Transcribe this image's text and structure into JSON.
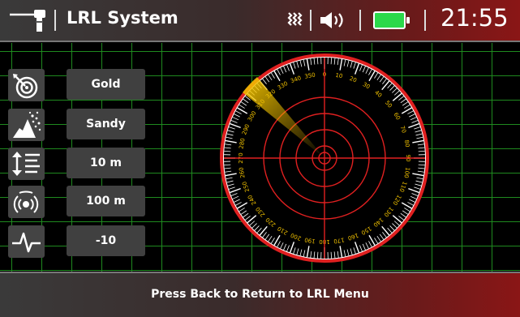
{
  "header": {
    "title": "LRL System",
    "time": "21:55",
    "icons": [
      "lrl-device-icon",
      "signal-icon",
      "volume-icon",
      "battery-icon"
    ],
    "battery_color": "#2bd94a"
  },
  "settings": [
    {
      "icon": "target-icon",
      "value": "Gold"
    },
    {
      "icon": "soil-icon",
      "value": "Sandy"
    },
    {
      "icon": "depth-icon",
      "value": "10 m"
    },
    {
      "icon": "range-icon",
      "value": "100 m"
    },
    {
      "icon": "sensitivity-icon",
      "value": "-10"
    }
  ],
  "radar": {
    "ring_color": "#e02020",
    "sweep_color": "#f2c200",
    "bearing_labels": [
      "0",
      "10",
      "20",
      "30",
      "40",
      "50",
      "60",
      "70",
      "80",
      "90",
      "100",
      "110",
      "120",
      "130",
      "140",
      "150",
      "160",
      "170",
      "180",
      "190",
      "200",
      "210",
      "220",
      "230",
      "240",
      "250",
      "260",
      "270",
      "280",
      "290",
      "300",
      "310",
      "320",
      "330",
      "340",
      "350"
    ]
  },
  "footer": {
    "message": "Press Back to Return to LRL Menu"
  }
}
